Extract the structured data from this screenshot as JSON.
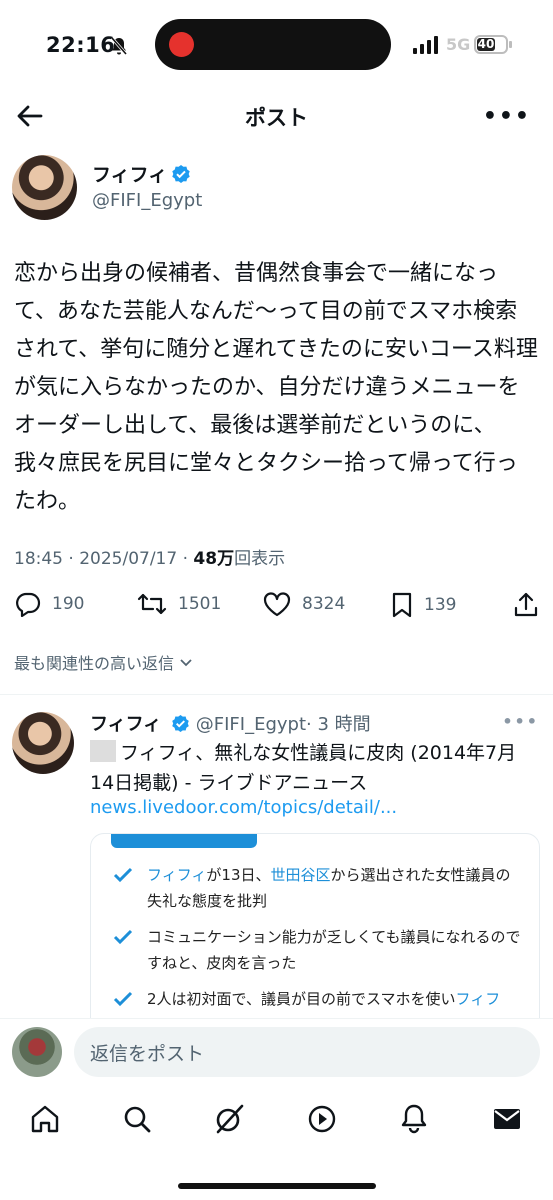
{
  "status": {
    "time": "22:16",
    "network": "5G",
    "battery": "40"
  },
  "header": {
    "title": "ポスト"
  },
  "post": {
    "author_name": "フィフィ",
    "author_handle": "@FIFI_Egypt",
    "text": "恋から出身の候補者、昔偶然食事会で一緒になって、あなた芸能人なんだ〜って目の前でスマホ検索されて、挙句に随分と遅れてきたのに安いコース料理が気に入らなかったのか、自分だけ違うメニューをオーダーし出して、最後は選挙前だというのに、我々庶民を尻目に堂々とタクシー拾って帰って行ったわ。",
    "timestamp": "18:45 · 2025/07/17 · ",
    "views_count": "48万",
    "views_label": "回表示",
    "replies": "190",
    "reposts": "1501",
    "likes": "8324",
    "bookmarks": "139"
  },
  "sort_label": "最も関連性の高い返信",
  "reply": {
    "author_name": "フィフィ",
    "author_handle": "@FIFI_Egypt",
    "time": "· 3 時間",
    "text": "フィフィ、無礼な女性議員に皮肉 (2014年7月14日掲載) - ライブドアニュース",
    "link": "news.livedoor.com/topics/detail/...",
    "card_items": [
      {
        "highlight": "フィフィ",
        "mid": "が13日、",
        "highlight2": "世田谷区",
        "rest": "から選出された女性議員の失礼な態度を批判"
      },
      {
        "highlight": "",
        "mid": "コミュニケーション能力が乏しくても議員になれるのですねと、皮肉を言った",
        "highlight2": "",
        "rest": ""
      },
      {
        "highlight": "",
        "mid": "2人は初対面で、議員が目の前でスマホを使い",
        "highlight2": "フィフ",
        "rest": ""
      }
    ]
  },
  "compose": {
    "placeholder": "返信をポスト"
  },
  "icons": {
    "back": "arrow-left-icon",
    "more": "more-icon",
    "verified": "verified-badge-icon",
    "reply": "reply-icon",
    "repost": "repost-icon",
    "like": "heart-icon",
    "bookmark": "bookmark-icon",
    "share": "share-icon",
    "tabs": [
      "home-icon",
      "search-icon",
      "grok-icon",
      "video-icon",
      "notifications-icon",
      "messages-icon"
    ]
  },
  "colors": {
    "accent": "#1d9bf0",
    "text": "#0f1419",
    "secondary": "#536471"
  }
}
